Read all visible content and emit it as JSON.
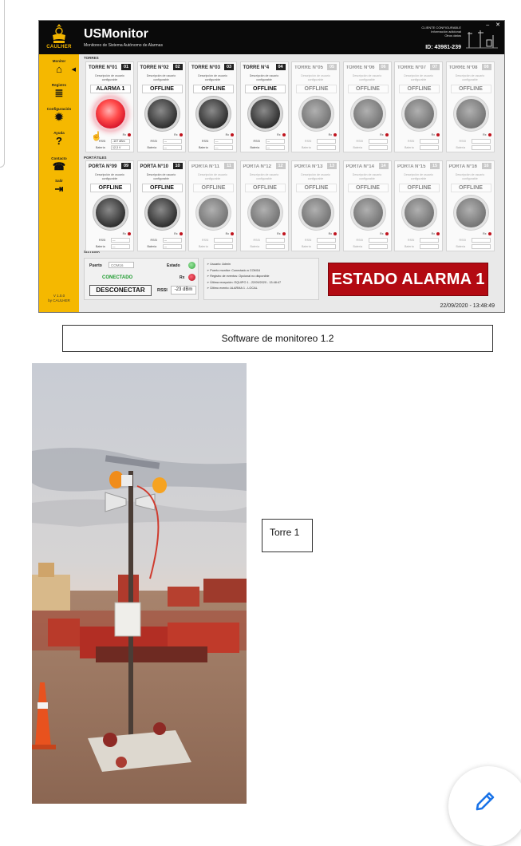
{
  "app": {
    "logo_text": "CAULHER",
    "title": "USMonitor",
    "subtitle": "Monitoreo de Sistema Autónomo de Alarmas",
    "client_info": [
      "CLIENTE CONFIGURABLE",
      "Información adicional",
      "Otros datos"
    ],
    "client_id": "ID: 43981-239",
    "window_controls": "– ✕",
    "sidebar": [
      {
        "label": "Monitor",
        "icon": "home-icon",
        "glyph": "⌂"
      },
      {
        "label": "Registro",
        "icon": "database-icon",
        "glyph": "≣"
      },
      {
        "label": "Configuración",
        "icon": "gear-icon",
        "glyph": "✹"
      },
      {
        "label": "Ayuda",
        "icon": "help-book-icon",
        "glyph": "?"
      },
      {
        "label": "Contacto",
        "icon": "contact-icon",
        "glyph": "☎"
      },
      {
        "label": "Salir",
        "icon": "exit-icon",
        "glyph": "⇥"
      }
    ],
    "version": "V 1.0.0",
    "version_by": "by CAULHER",
    "section_towers": "TORRES",
    "section_portables": "PORTÁTILES",
    "section_system": "SISTEMA",
    "card_desc_line1": "Descripción de usuario",
    "card_desc_line2": "configurable",
    "rx_label": "Rx",
    "rssi_label": "RSSI",
    "battery_label": "Batería",
    "towers": [
      {
        "name": "TORRE N°01",
        "num": "01",
        "status": "ALARMA 1",
        "rssi": "-107 dBm",
        "battery": "12,3 V"
      },
      {
        "name": "TORRE N°02",
        "num": "02",
        "status": "OFFLINE",
        "rssi": "---",
        "battery": "---"
      },
      {
        "name": "TORRE N°03",
        "num": "03",
        "status": "OFFLINE",
        "rssi": "---",
        "battery": "---"
      },
      {
        "name": "TORRE N°4",
        "num": "04",
        "status": "OFFLINE",
        "rssi": "---",
        "battery": "---"
      },
      {
        "name": "TORRE N°05",
        "num": "05",
        "status": "OFFLINE",
        "rssi": "",
        "battery": ""
      },
      {
        "name": "TORRE N°06",
        "num": "06",
        "status": "OFFLINE",
        "rssi": "",
        "battery": ""
      },
      {
        "name": "TORRE N°07",
        "num": "07",
        "status": "OFFLINE",
        "rssi": "",
        "battery": ""
      },
      {
        "name": "TORRE N°08",
        "num": "08",
        "status": "OFFLINE",
        "rssi": "",
        "battery": ""
      }
    ],
    "portables": [
      {
        "name": "PORTA N°09",
        "num": "09",
        "status": "OFFLINE",
        "rssi": "---",
        "battery": "---"
      },
      {
        "name": "PORTA N°10",
        "num": "10",
        "status": "OFFLINE",
        "rssi": "---",
        "battery": "---"
      },
      {
        "name": "PORTA N°11",
        "num": "11",
        "status": "OFFLINE",
        "rssi": "",
        "battery": ""
      },
      {
        "name": "PORTA N°12",
        "num": "12",
        "status": "OFFLINE",
        "rssi": "",
        "battery": ""
      },
      {
        "name": "PORTA N°13",
        "num": "13",
        "status": "OFFLINE",
        "rssi": "",
        "battery": ""
      },
      {
        "name": "PORTA N°14",
        "num": "14",
        "status": "OFFLINE",
        "rssi": "",
        "battery": ""
      },
      {
        "name": "PORTA N°15",
        "num": "15",
        "status": "OFFLINE",
        "rssi": "",
        "battery": ""
      },
      {
        "name": "PORTA N°16",
        "num": "16",
        "status": "OFFLINE",
        "rssi": "",
        "battery": ""
      }
    ],
    "system": {
      "port_label": "Puerto",
      "port_value": "COM16",
      "connection_state": "CONECTADO",
      "disconnect_button": "DESCONECTAR",
      "estado_label": "Estado",
      "rx_label": "Rx",
      "rssi_label": "RSSI",
      "rssi_value": "-23 dBm"
    },
    "log": [
      "Usuario: Admin",
      "Puerto monitor: Conectado a COM16",
      "Registro de eventos: Opcional no disponible",
      "Última recepción: EQUIPO 1 - 22/09/2020 - 13:48:47",
      "Último evento: ALARMA 1 - LOCAL"
    ],
    "alarm_banner": "ESTADO ALARMA 1",
    "datetime": "22/09/2020 - 13:48:49",
    "colors": {
      "sidebar": "#f5b800",
      "topbar": "#0a0a0a",
      "alarm": "#b30a12",
      "connected": "#1b9a2c"
    }
  },
  "caption_software": "Software de monitoreo 1.2",
  "caption_tower": "Torre 1",
  "edit_button_icon": "pencil-icon"
}
